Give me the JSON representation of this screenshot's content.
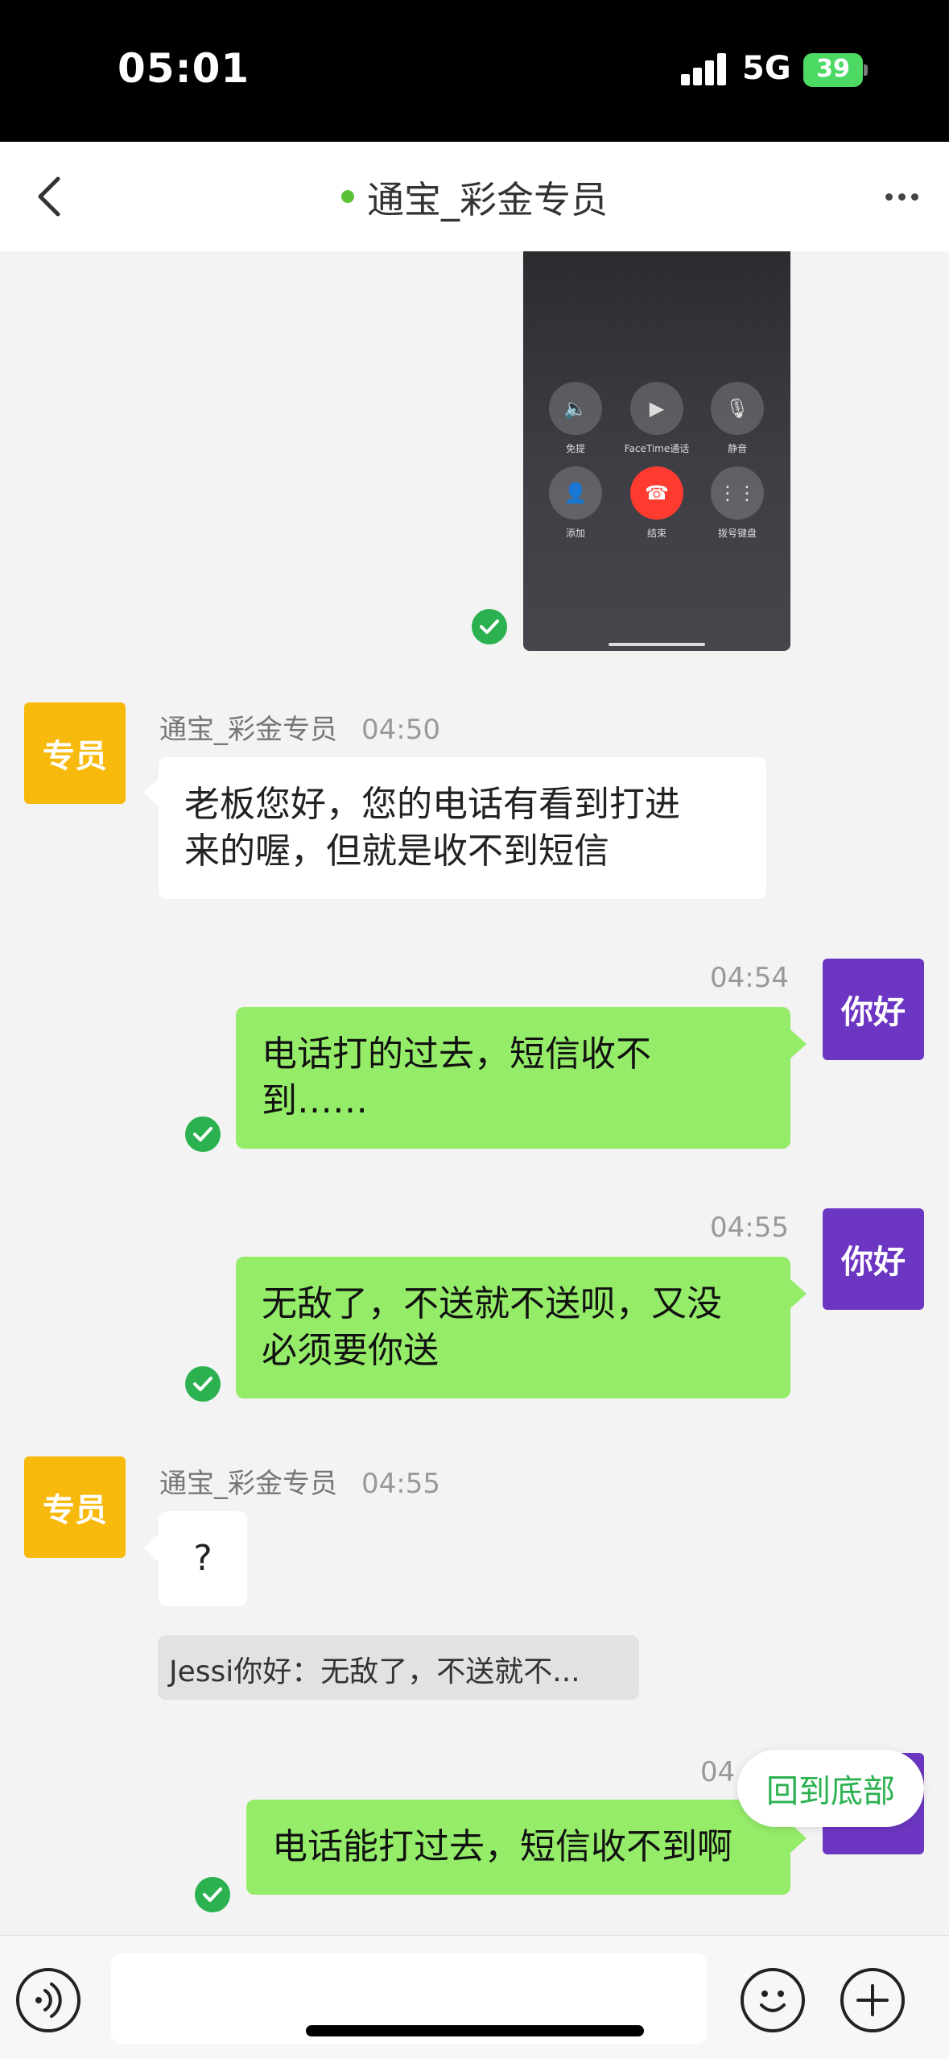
{
  "status_bar": {
    "time": "05:01",
    "network": "5G",
    "battery": "39"
  },
  "nav": {
    "title": "通宝_彩金专员",
    "online_color": "#5bc236"
  },
  "call_screenshot": {
    "buttons": [
      {
        "label": "免提",
        "icon": "speaker-icon"
      },
      {
        "label": "FaceTime通话",
        "icon": "facetime-icon"
      },
      {
        "label": "静音",
        "icon": "mute-icon"
      },
      {
        "label": "添加",
        "icon": "add-contact-icon"
      },
      {
        "label": "结束",
        "icon": "end-call-icon"
      },
      {
        "label": "拨号键盘",
        "icon": "keypad-icon"
      }
    ]
  },
  "messages": [
    {
      "side": "left",
      "avatar": "专员",
      "name": "通宝_彩金专员",
      "time": "04:50",
      "lines": [
        "老板您好，您的电话有看到打进",
        "来的喔，但就是收不到短信"
      ]
    },
    {
      "side": "right",
      "avatar": "你好",
      "time": "04:54",
      "lines": [
        "电话打的过去，短信收不",
        "到……"
      ]
    },
    {
      "side": "right",
      "avatar": "你好",
      "time": "04:55",
      "lines": [
        "无敌了，不送就不送呗，又没",
        "必须要你送"
      ]
    },
    {
      "side": "left",
      "avatar": "专员",
      "name": "通宝_彩金专员",
      "time": "04:55",
      "lines": [
        "?"
      ],
      "quote": "Jessi你好：无敌了，不送就不..."
    },
    {
      "side": "right",
      "avatar": "你好",
      "time": "04",
      "lines": [
        "电话能打过去，短信收不到啊"
      ]
    }
  ],
  "back_to_bottom": "回到底部",
  "colors": {
    "accent_green": "#2bb14f",
    "bubble_green": "#95ec69",
    "avatar_yellow": "#f8b90d",
    "avatar_purple": "#6c36c2"
  }
}
